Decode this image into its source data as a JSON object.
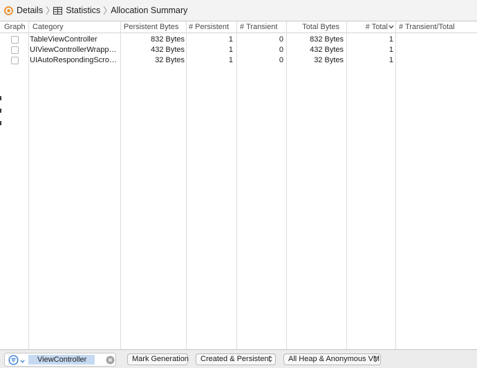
{
  "breadcrumb": {
    "items": [
      {
        "label": "Details",
        "icon": "instruments-details-icon"
      },
      {
        "label": "Statistics",
        "icon": "table-grid-icon"
      },
      {
        "label": "Allocation Summary"
      }
    ]
  },
  "table": {
    "columns": {
      "graph": "Graph",
      "category": "Category",
      "persistent_bytes": "Persistent Bytes",
      "persistent_count": "# Persistent",
      "transient_count": "# Transient",
      "total_bytes": "Total Bytes",
      "total_count": "# Total",
      "transient_total": "# Transient/Total"
    },
    "sorted_column": "# Total",
    "sort_direction": "descending",
    "rows": [
      {
        "graph_checked": false,
        "category": "TableViewController",
        "persistent_bytes": "832 Bytes",
        "persistent_count": "1",
        "transient_count": "0",
        "total_bytes": "832 Bytes",
        "total_count": "1",
        "transient_total": ""
      },
      {
        "graph_checked": false,
        "category": "UIViewControllerWrappe...",
        "persistent_bytes": "432 Bytes",
        "persistent_count": "1",
        "transient_count": "0",
        "total_bytes": "432 Bytes",
        "total_count": "1",
        "transient_total": ""
      },
      {
        "graph_checked": false,
        "category": "UIAutoRespondingScroll...",
        "persistent_bytes": "32 Bytes",
        "persistent_count": "1",
        "transient_count": "0",
        "total_bytes": "32 Bytes",
        "total_count": "1",
        "transient_total": ""
      }
    ]
  },
  "bottom_bar": {
    "filter_value": "ViewController",
    "mark_generation": "Mark Generation",
    "lifespan_popup": "Created & Persistent",
    "heap_popup": "All Heap & Anonymous VM"
  },
  "colors": {
    "accent": "#2f7bd6",
    "selection": "#c5d9f1",
    "details_icon": "#e98a20"
  }
}
